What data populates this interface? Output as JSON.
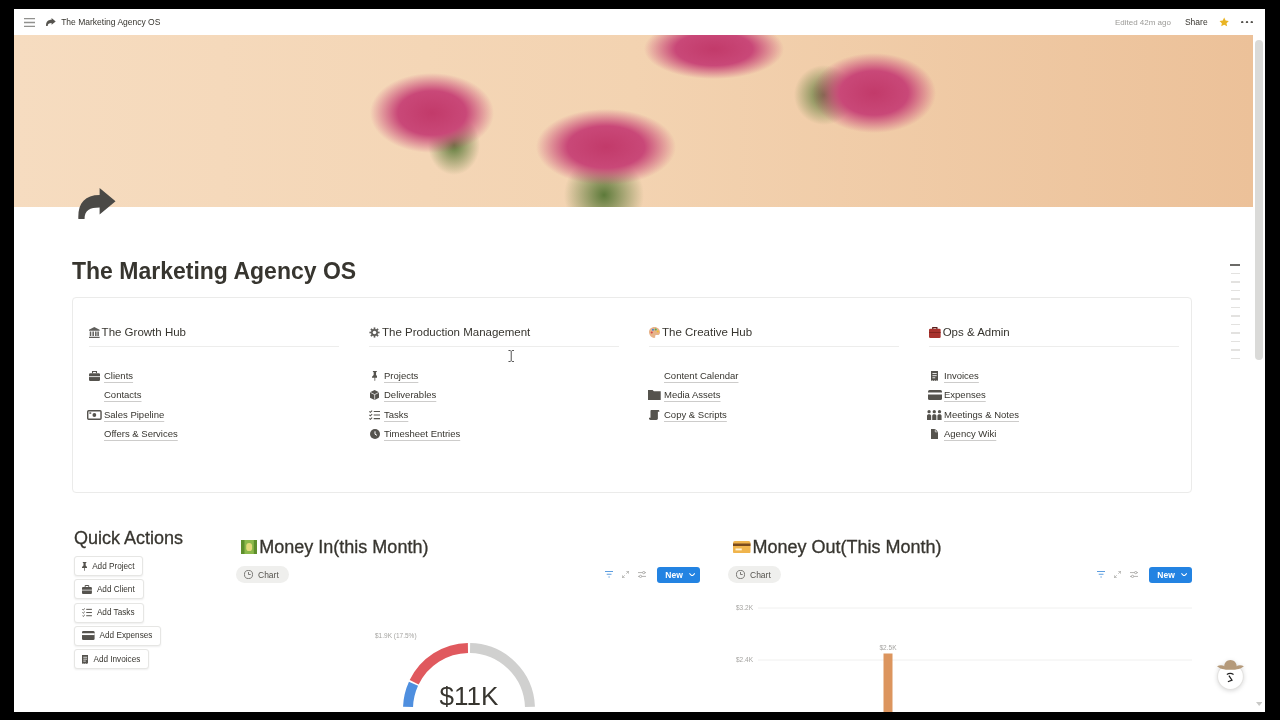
{
  "top_bar": {
    "breadcrumb": "The Marketing Agency OS",
    "edited": "Edited 42m ago",
    "share": "Share",
    "favorite": true
  },
  "page": {
    "title": "The Marketing Agency OS"
  },
  "hubs": [
    {
      "title": "The Growth Hub",
      "links": [
        "Clients",
        "Contacts",
        "Sales Pipeline",
        "Offers & Services"
      ]
    },
    {
      "title": "The Production Management",
      "links": [
        "Projects",
        "Deliverables",
        "Tasks",
        "Timesheet Entries"
      ]
    },
    {
      "title": "The Creative Hub",
      "links": [
        "Content Calendar",
        "Media Assets",
        "Copy & Scripts"
      ]
    },
    {
      "title": "Ops & Admin",
      "links": [
        "Invoices",
        "Expenses",
        "Meetings & Notes",
        "Agency Wiki"
      ]
    }
  ],
  "quick_actions": {
    "title": "Quick Actions",
    "buttons": [
      "Add Project",
      "Add Client",
      "Add Tasks",
      "Add Expenses",
      "Add Invoices"
    ]
  },
  "money_in": {
    "title": "Money In(this Month)",
    "views": [
      {
        "label": "Chart",
        "selected": true
      }
    ],
    "filter_active": true,
    "new_button": "New",
    "donut": {
      "slice_label": "$1.9K (17.5%)",
      "total": "$11K"
    }
  },
  "money_out": {
    "title": "Money Out(This Month)",
    "views": [
      {
        "label": "Chart",
        "selected": true
      }
    ],
    "filter_active": true,
    "new_button": "New",
    "chart_data": {
      "type": "bar",
      "values": [
        2500
      ],
      "ylim": [
        1600,
        3200
      ],
      "yticks": [
        {
          "value": 2400,
          "label": "$2.4K"
        },
        {
          "value": 3200,
          "label": "$3.2K"
        }
      ],
      "value_labels": [
        "$2.5K"
      ]
    }
  },
  "outline": [
    {
      "selected": true
    },
    {
      "selected": false
    },
    {
      "selected": false
    },
    {
      "selected": false
    },
    {
      "selected": false
    },
    {
      "selected": false
    },
    {
      "selected": false
    },
    {
      "selected": false
    },
    {
      "selected": false
    },
    {
      "selected": false
    },
    {
      "selected": false
    },
    {
      "selected": false
    }
  ]
}
